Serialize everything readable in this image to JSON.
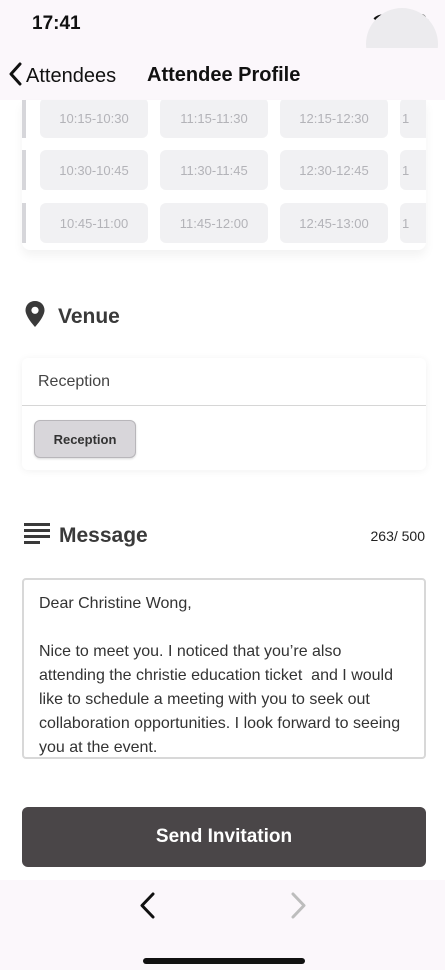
{
  "status_bar": {
    "time": "17:41"
  },
  "nav": {
    "back_label": "Attendees",
    "title": "Attendee Profile"
  },
  "time_slots": {
    "rows": [
      [
        "10:15-10:30",
        "11:15-11:30",
        "12:15-12:30",
        "1"
      ],
      [
        "10:30-10:45",
        "11:30-11:45",
        "12:30-12:45",
        "1"
      ],
      [
        "10:45-11:00",
        "11:45-12:00",
        "12:45-13:00",
        "1"
      ]
    ]
  },
  "venue": {
    "title": "Venue",
    "selected": "Reception",
    "options": [
      "Reception"
    ]
  },
  "message": {
    "title": "Message",
    "count": "263/ 500",
    "text": "Dear Christine Wong,\n\nNice to meet you. I noticed that you’re also attending the christie education ticket  and I would like to schedule a meeting with you to seek out collaboration opportunities. I look forward to seeing you at the event."
  },
  "actions": {
    "send_label": "Send Invitation"
  },
  "colors": {
    "button_bg": "#4a4648",
    "slot_bg": "#f1f1f3",
    "bar_bg": "#fbf7fb"
  }
}
